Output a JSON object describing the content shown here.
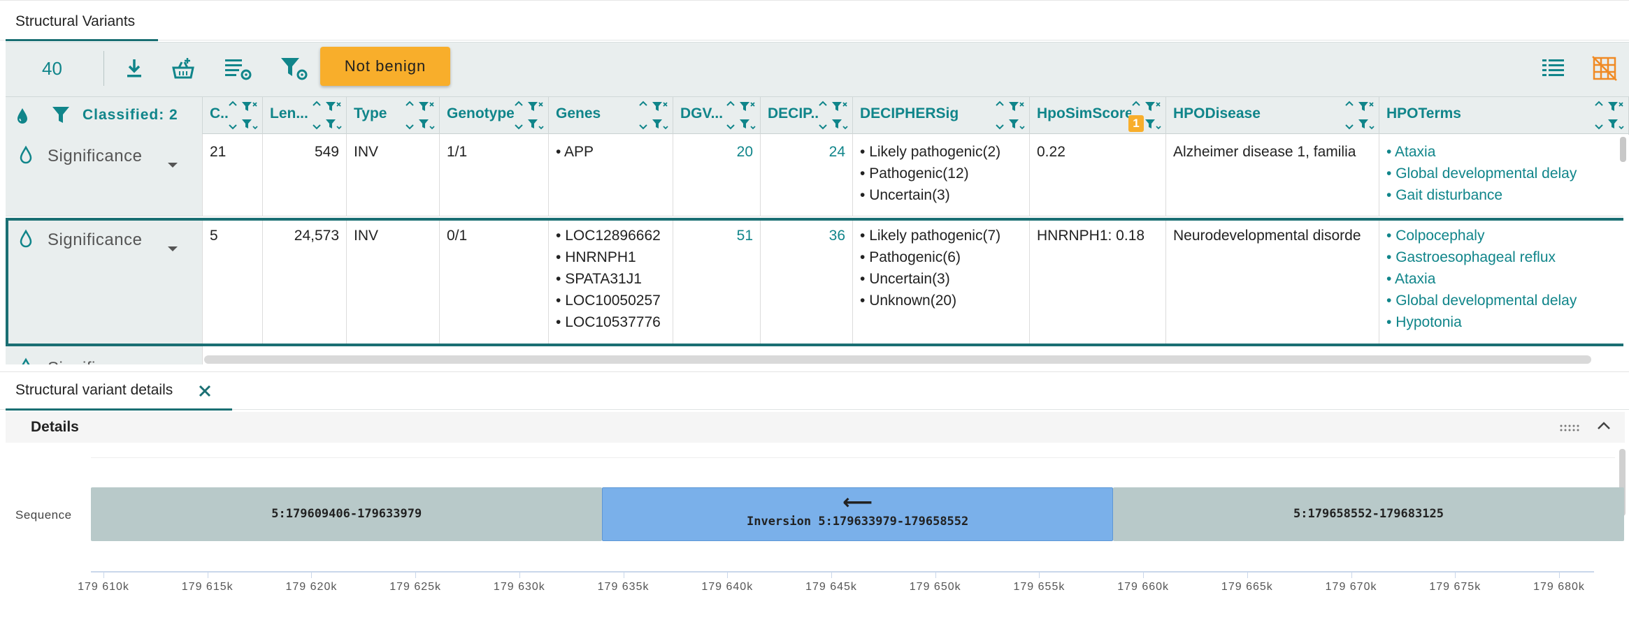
{
  "tabs": {
    "structural_variants": "Structural Variants",
    "details": "Structural variant details"
  },
  "toolbar": {
    "count": "40",
    "not_benign_label": "Not benign",
    "icons": [
      "download-icon",
      "add-to-basket-icon",
      "column-settings-icon",
      "filter-settings-icon",
      "column-layout-icon",
      "grid-off-icon"
    ]
  },
  "header": {
    "classified_label": "Classified: 2",
    "hpo_badge": "1",
    "columns": [
      {
        "key": "c",
        "label": "C..."
      },
      {
        "key": "length",
        "label": "Len..."
      },
      {
        "key": "type",
        "label": "Type"
      },
      {
        "key": "genotype",
        "label": "Genotype"
      },
      {
        "key": "genes",
        "label": "Genes"
      },
      {
        "key": "dgv",
        "label": "DGV..."
      },
      {
        "key": "decip",
        "label": "DECIP..."
      },
      {
        "key": "deciphersig",
        "label": "DECIPHERSig"
      },
      {
        "key": "hposimscore",
        "label": "HpoSimScore"
      },
      {
        "key": "hpodisease",
        "label": "HPODisease"
      },
      {
        "key": "hpoterms",
        "label": "HPOTerms"
      }
    ]
  },
  "rows": [
    {
      "significance": "Significance",
      "c": "21",
      "length": "549",
      "type": "INV",
      "genotype": "1/1",
      "genes": [
        "APP"
      ],
      "dgv": "20",
      "decip": "24",
      "deciphersig": [
        "Likely pathogenic(2)",
        "Pathogenic(12)",
        "Uncertain(3)"
      ],
      "hposimscore": "0.22",
      "hpodisease": "Alzheimer disease 1, familia",
      "hpoterms": [
        "Ataxia",
        "Global developmental delay",
        "Gait disturbance"
      ]
    },
    {
      "significance": "Significance",
      "c": "5",
      "length": "24,573",
      "type": "INV",
      "genotype": "0/1",
      "genes": [
        "LOC12896662",
        "HNRNPH1",
        "SPATA31J1",
        "LOC10050257",
        "LOC10537776"
      ],
      "dgv": "51",
      "decip": "36",
      "deciphersig": [
        "Likely pathogenic(7)",
        "Pathogenic(6)",
        "Uncertain(3)",
        "Unknown(20)"
      ],
      "hposimscore": "HNRNPH1: 0.18",
      "hpodisease": "Neurodevelopmental disorde",
      "hpoterms": [
        "Colpocephaly",
        "Gastroesophageal reflux",
        "Ataxia",
        "Global developmental delay",
        "Hypotonia"
      ]
    },
    {
      "significance": "Significa"
    }
  ],
  "details": {
    "title": "Details",
    "sequence_label": "Sequence",
    "segments": [
      {
        "label": "5:179609406-179633979",
        "start": 179609406,
        "end": 179633979,
        "kind": "flank"
      },
      {
        "label": "Inversion 5:179633979-179658552",
        "start": 179633979,
        "end": 179658552,
        "kind": "inversion",
        "arrow": "⟵"
      },
      {
        "label": "5:179658552-179683125",
        "start": 179658552,
        "end": 179683125,
        "kind": "flank"
      }
    ],
    "axis": {
      "min": 179610000,
      "max": 179680000,
      "ticks": [
        "179 610k",
        "179 615k",
        "179 620k",
        "179 625k",
        "179 630k",
        "179 635k",
        "179 640k",
        "179 645k",
        "179 650k",
        "179 655k",
        "179 660k",
        "179 665k",
        "179 670k",
        "179 675k",
        "179 680k"
      ]
    },
    "colors": {
      "flank": "#b8c9c9",
      "inversion": "#7ab0ea"
    }
  },
  "colors": {
    "accent": "#10858a",
    "button": "#f8ae2b",
    "selected_border": "#1a6f73"
  }
}
